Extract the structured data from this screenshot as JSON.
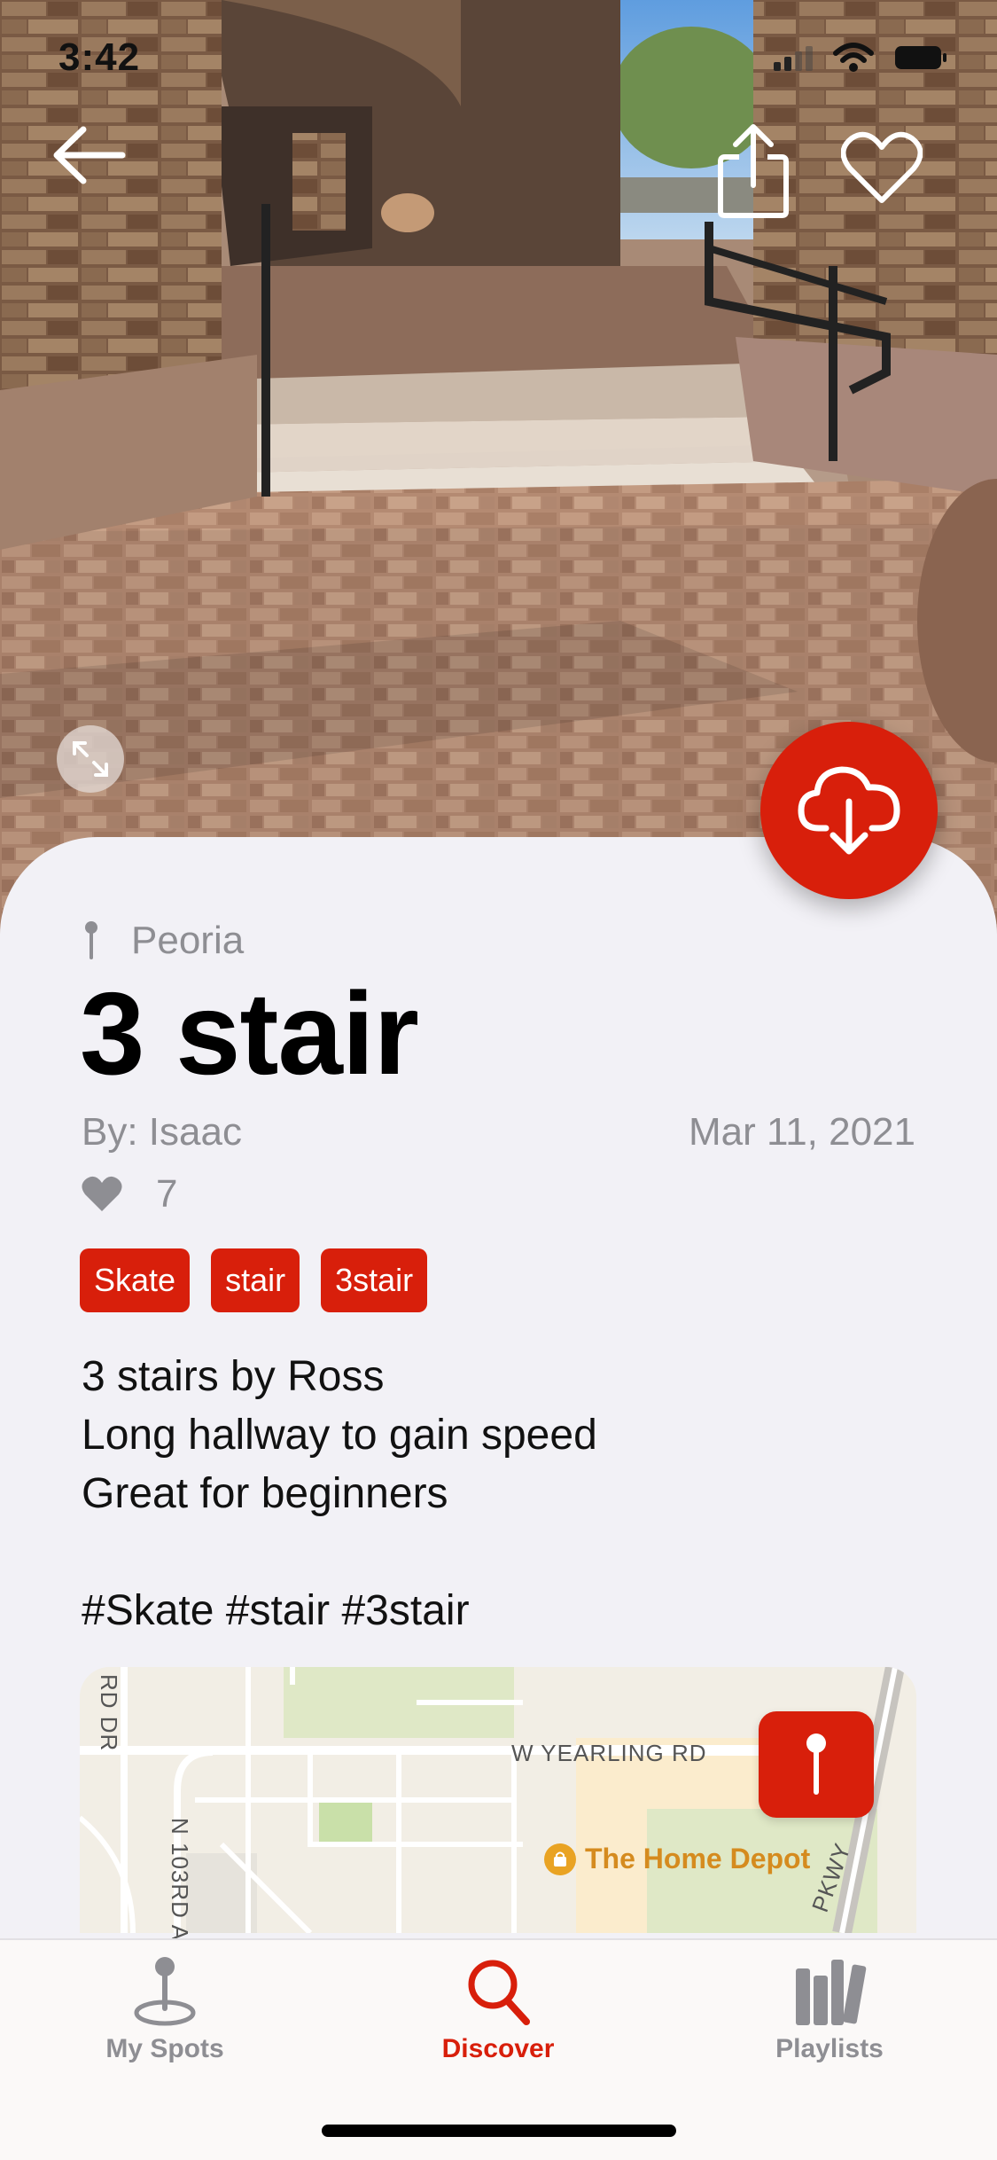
{
  "status_bar": {
    "time": "3:42"
  },
  "colors": {
    "accent": "#d81f0b",
    "secondary_text": "#8e8e93",
    "background": "#f2f1f6"
  },
  "hero": {
    "back_icon": "arrow-left-icon",
    "share_icon": "share-icon",
    "favorite_icon": "heart-outline-icon",
    "expand_icon": "expand-icon",
    "download_icon": "cloud-download-icon"
  },
  "spot": {
    "location": "Peoria",
    "title": "3 stair",
    "author": "By: Isaac",
    "date": "Mar 11, 2021",
    "likes": "7",
    "tags": [
      "Skate",
      "stair",
      "3stair"
    ],
    "description": "3 stairs by Ross\nLong hallway to gain speed\nGreat for beginners\n\n#Skate #stair #3stair"
  },
  "map": {
    "roads": [
      "W YEARLING RD",
      "RD DR",
      "N 103RD AV",
      "PKWY"
    ],
    "poi": "The Home Depot"
  },
  "tabbar": {
    "tabs": [
      {
        "label": "My Spots",
        "icon": "map-pin-icon",
        "active": false
      },
      {
        "label": "Discover",
        "icon": "search-icon",
        "active": true
      },
      {
        "label": "Playlists",
        "icon": "books-icon",
        "active": false
      }
    ]
  }
}
